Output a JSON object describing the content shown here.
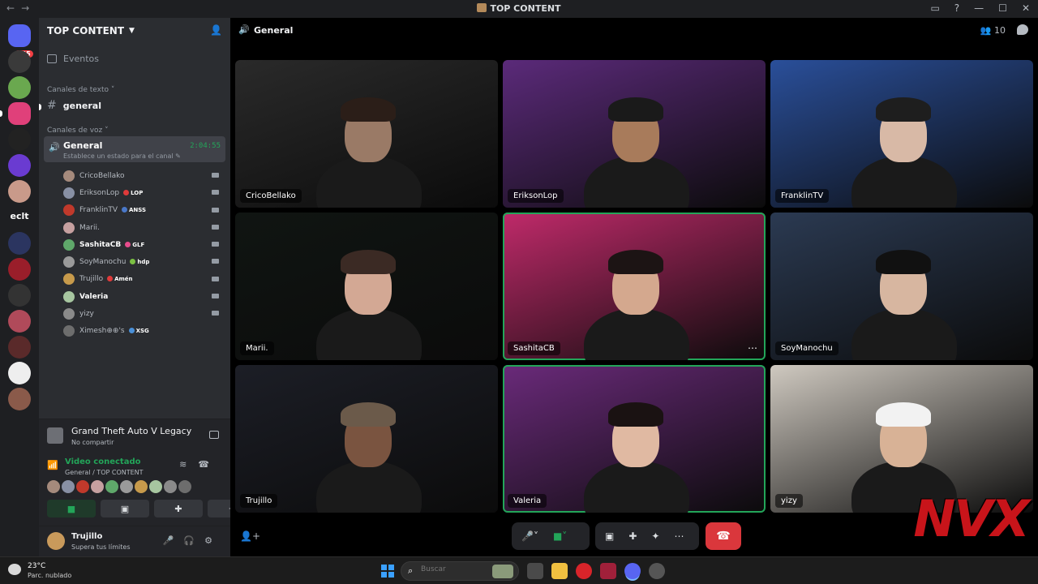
{
  "window": {
    "title": "TOP CONTENT",
    "nav_back": "←",
    "nav_fwd": "→",
    "controls": [
      "▭",
      "?",
      "—",
      "☐",
      "✕"
    ]
  },
  "rail": {
    "badge": "645",
    "text_server": "eclt"
  },
  "server": {
    "name": "TOP CONTENT",
    "events_label": "Eventos",
    "text_category": "Canales de texto",
    "text_channel": "general",
    "voice_category": "Canales de voz"
  },
  "voice_channel": {
    "name": "General",
    "status": "Establece un estado para el canal",
    "timer": "2:04:55"
  },
  "members": [
    {
      "name": "CricoBellako",
      "tag": "",
      "bold": false,
      "color": "#a58a7c"
    },
    {
      "name": "EriksonLop",
      "tag": "LOP",
      "bold": false,
      "color": "#8890a4",
      "tag_color": "#e03a3a"
    },
    {
      "name": "FranklinTV",
      "tag": "ANSS",
      "bold": false,
      "color": "#c0392b",
      "tag_color": "#4a78c8"
    },
    {
      "name": "Marii.",
      "tag": "",
      "bold": false,
      "color": "#c6a0a0"
    },
    {
      "name": "SashitaCB",
      "tag": "GLF",
      "bold": true,
      "color": "#5fa86a",
      "tag_color": "#e74c8c"
    },
    {
      "name": "SoyManochu",
      "tag": "hdp",
      "bold": false,
      "color": "#9a9a9a",
      "tag_color": "#7bc043"
    },
    {
      "name": "Trujillo",
      "tag": "Amén",
      "bold": false,
      "color": "#c79a4b",
      "tag_color": "#e03a3a"
    },
    {
      "name": "Valeria",
      "tag": "",
      "bold": true,
      "color": "#a7c6a0"
    },
    {
      "name": "yizy",
      "tag": "",
      "bold": false,
      "color": "#8a8a8a"
    },
    {
      "name": "Ximesh⊕⊕'s",
      "tag": "XSG",
      "bold": false,
      "color": "#6d6d6d",
      "tag_color": "#4a90d9"
    }
  ],
  "activity": {
    "game": "Grand Theft Auto V Legacy",
    "share": "No compartir"
  },
  "voice_panel": {
    "connected": "Video conectado",
    "location": "General / TOP CONTENT"
  },
  "user": {
    "name": "Trujillo",
    "status": "Supera tus límites"
  },
  "main": {
    "channel": "General",
    "participant_count": "10"
  },
  "tiles": [
    {
      "name": "CricoBellako",
      "bg": "#2a2a2a",
      "skin": "#9a7a66",
      "hair": "#2b1e18",
      "speaking": false
    },
    {
      "name": "EriksonLop",
      "bg": "#5b2a7a",
      "skin": "#a87b5b",
      "hair": "#1a1a1a",
      "speaking": false
    },
    {
      "name": "FranklinTV",
      "bg": "#2a4f9a",
      "skin": "#d8b9a6",
      "hair": "#1e1e1e",
      "speaking": false
    },
    {
      "name": "Marii.",
      "bg": "#101512",
      "skin": "#d3a894",
      "hair": "#3b2a24",
      "speaking": false
    },
    {
      "name": "SashitaCB",
      "bg": "#c02a6a",
      "skin": "#d4a88e",
      "hair": "#1c1414",
      "speaking": true
    },
    {
      "name": "SoyManochu",
      "bg": "#2b3a52",
      "skin": "#d7b6a0",
      "hair": "#111111",
      "speaking": false
    },
    {
      "name": "Trujillo",
      "bg": "#1c1e26",
      "skin": "#7a5440",
      "hair": "#6b5a4a",
      "speaking": false
    },
    {
      "name": "Valeria",
      "bg": "#6a2a7a",
      "skin": "#e0b9a2",
      "hair": "#1a1212",
      "speaking": true
    },
    {
      "name": "yizy",
      "bg": "#cfc9c0",
      "skin": "#d8b296",
      "hair": "#f2f2f2",
      "speaking": false
    }
  ],
  "taskbar": {
    "temp": "23°C",
    "weather": "Parc. nublado",
    "search_placeholder": "Buscar"
  },
  "watermark": "NVX"
}
